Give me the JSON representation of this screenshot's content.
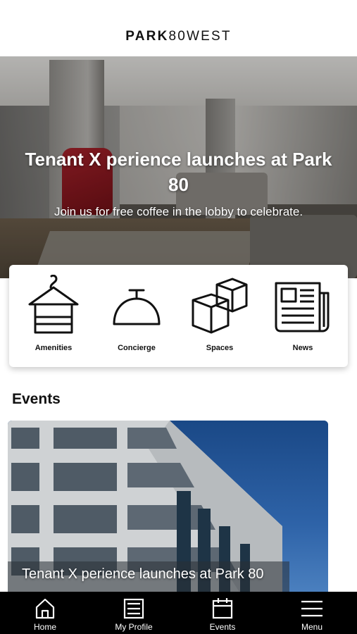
{
  "header": {
    "logo_bold": "PARK",
    "logo_light": "80WEST"
  },
  "hero": {
    "title": "Tenant X perience launches at Park 80",
    "subtitle": "Join us for free coffee in the lobby to celebrate."
  },
  "quick_links": [
    {
      "label": "Amenities",
      "icon": "hanger-towel-icon"
    },
    {
      "label": "Concierge",
      "icon": "service-bell-icon"
    },
    {
      "label": "Spaces",
      "icon": "boxes-icon"
    },
    {
      "label": "News",
      "icon": "newspaper-icon"
    }
  ],
  "events": {
    "section_title": "Events",
    "card_title": "Tenant X perience launches at Park 80"
  },
  "tabbar": {
    "items": [
      {
        "label": "Home",
        "icon": "home-icon"
      },
      {
        "label": "My Profile",
        "icon": "profile-card-icon"
      },
      {
        "label": "Events",
        "icon": "calendar-icon"
      },
      {
        "label": "Menu",
        "icon": "hamburger-menu-icon"
      }
    ]
  }
}
